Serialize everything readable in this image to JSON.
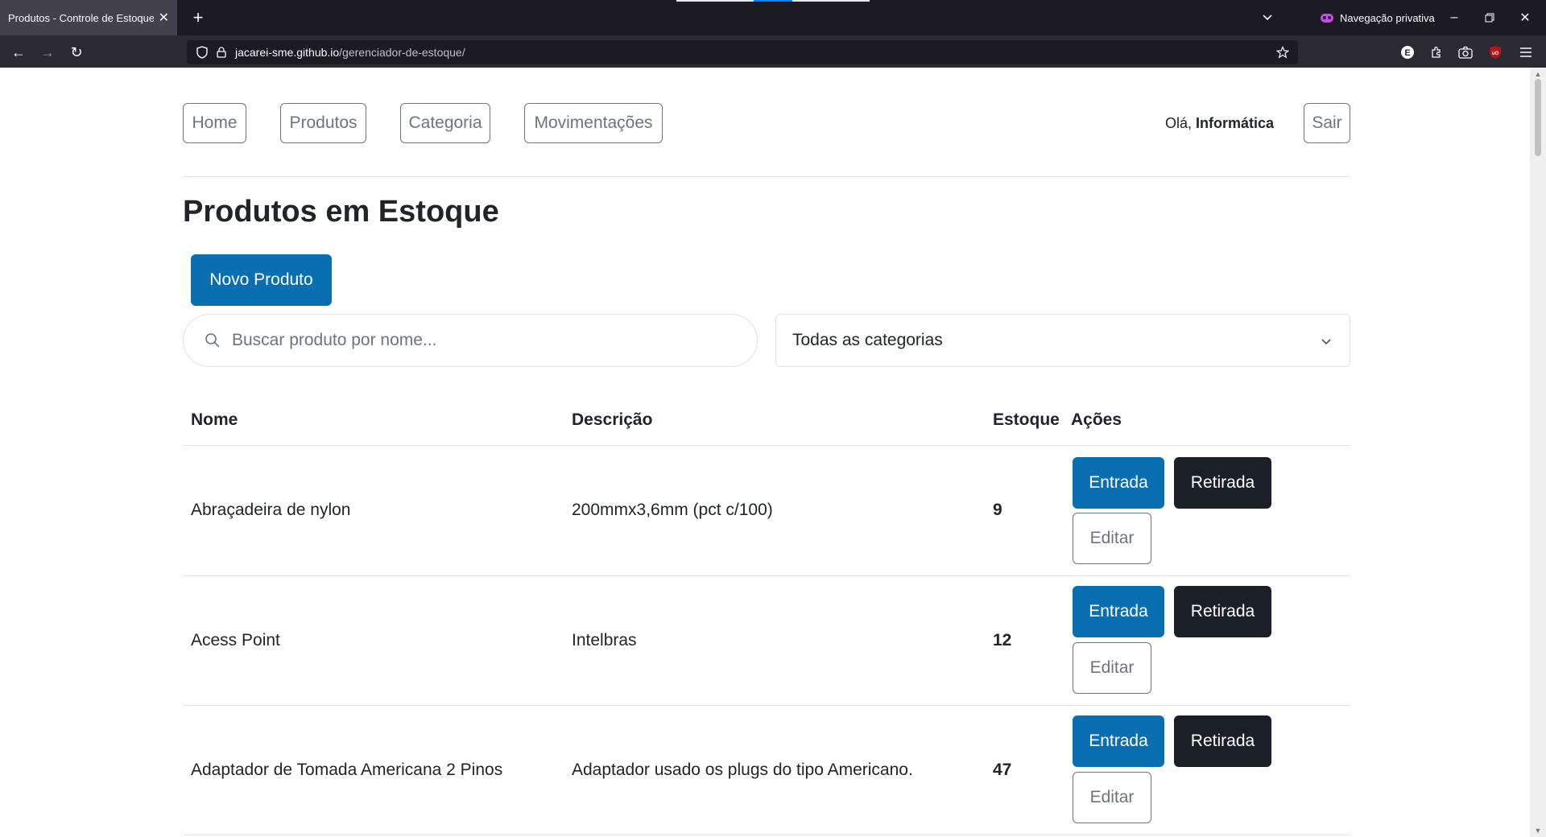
{
  "browser": {
    "tab_title": "Produtos - Controle de Estoque DTI",
    "private_label": "Navegação privativa",
    "url_host": "jacarei-sme.github.io",
    "url_path": "/gerenciador-de-estoque/",
    "colors": {
      "tabbar": "#1c1b22",
      "toolbar": "#2b2a33",
      "active_tab": "#42414d"
    }
  },
  "nav": {
    "items": [
      "Home",
      "Produtos",
      "Categoria",
      "Movimentações"
    ],
    "greeting_prefix": "Olá,",
    "user": "Informática",
    "logout": "Sair"
  },
  "page": {
    "title": "Produtos em Estoque",
    "new_button": "Novo Produto",
    "search_placeholder": "Buscar produto por nome...",
    "category_select": "Todas as categorias",
    "accent_color": "#0a6fb0",
    "dark_color": "#1b1f27"
  },
  "table": {
    "headers": [
      "Nome",
      "Descrição",
      "Estoque",
      "Ações"
    ],
    "rows": [
      {
        "name": "Abraçadeira de nylon",
        "description": "200mmx3,6mm (pct c/100)",
        "stock": "9"
      },
      {
        "name": "Acess Point",
        "description": "Intelbras",
        "stock": "12"
      },
      {
        "name": "Adaptador de Tomada Americana 2 Pinos",
        "description": "Adaptador usado os plugs do tipo Americano.",
        "stock": "47"
      }
    ],
    "actions": {
      "in": "Entrada",
      "out": "Retirada",
      "edit": "Editar"
    }
  }
}
